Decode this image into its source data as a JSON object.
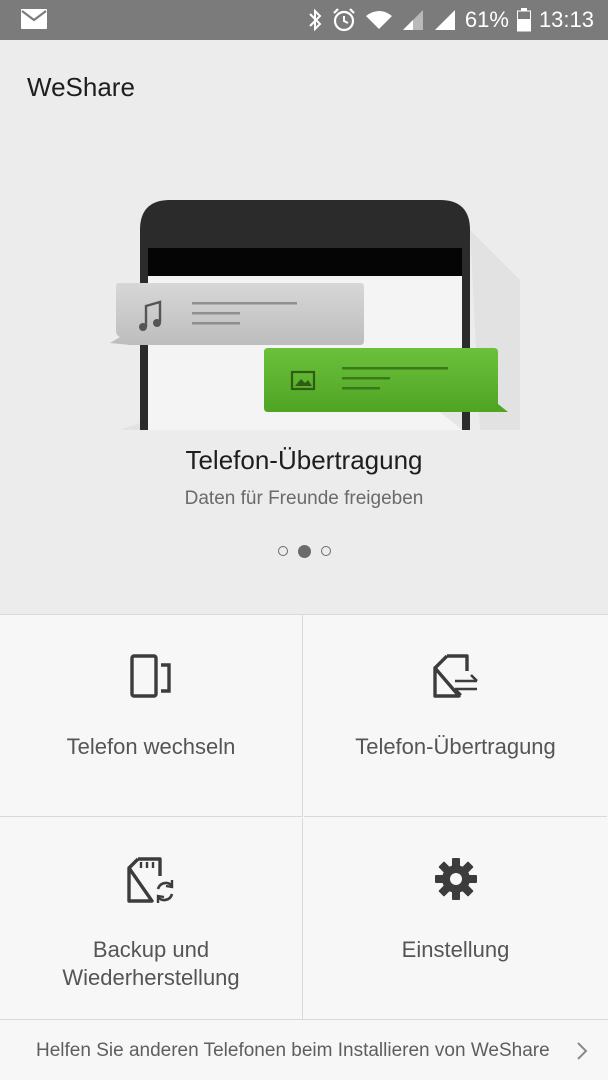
{
  "status_bar": {
    "battery": "61%",
    "time": "13:13",
    "icons": [
      "mail-icon",
      "bluetooth-icon",
      "alarm-icon",
      "wifi-icon",
      "signal-icon",
      "signal-icon",
      "battery-icon"
    ]
  },
  "app": {
    "title": "WeShare"
  },
  "carousel": {
    "title": "Telefon-Übertragung",
    "subtitle": "Daten für Freunde freigeben",
    "page_count": 3,
    "active_index": 1
  },
  "grid": {
    "items": [
      {
        "label": "Telefon wechseln",
        "icon": "phone-switch-icon"
      },
      {
        "label": "Telefon-Übertragung",
        "icon": "file-transfer-icon"
      },
      {
        "label": "Backup und\nWiederherstellung",
        "line1": "Backup und",
        "line2": "Wiederherstellung",
        "icon": "sdcard-sync-icon"
      },
      {
        "label": "Einstellung",
        "icon": "gear-icon"
      }
    ]
  },
  "footer": {
    "text": "Helfen Sie anderen Telefonen beim Installieren von WeShare",
    "icon": "chevron-right-icon"
  },
  "colors": {
    "status_bar": "#7b7b7b",
    "hero_bg": "#ececec",
    "accent_green": "#5bb12f",
    "bubble_gray": "#c8c8c8"
  }
}
